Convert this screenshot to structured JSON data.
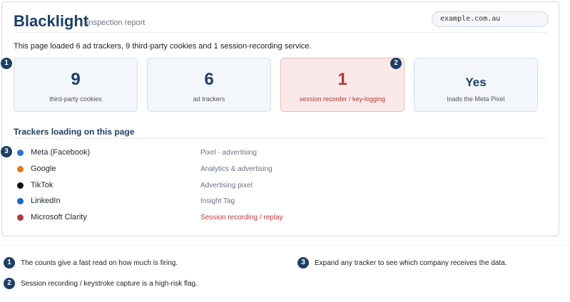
{
  "header": {
    "brand": "Blacklight",
    "subtitle": "inspection report",
    "url": "example.com.au"
  },
  "summary": "This page loaded 6 ad trackers, 9 third-party cookies and 1 session-recording service.",
  "stats": [
    {
      "value": "9",
      "label": "third-party cookies"
    },
    {
      "value": "6",
      "label": "ad trackers"
    },
    {
      "value": "1",
      "label": "session recorder / key-logging"
    },
    {
      "value": "Yes",
      "label": "loads the Meta Pixel"
    }
  ],
  "trackers_title": "Trackers loading on this page",
  "trackers": [
    {
      "name": "Meta (Facebook)",
      "desc": "Pixel · advertising",
      "color": "#2f6fd6"
    },
    {
      "name": "Google",
      "desc": "Analytics & advertising",
      "color": "#e07b1a"
    },
    {
      "name": "TikTok",
      "desc": "Advertising pixel",
      "color": "#111111"
    },
    {
      "name": "LinkedIn",
      "desc": "Insight Tag",
      "color": "#1a66c2"
    },
    {
      "name": "Microsoft Clarity",
      "desc": "Session recording / replay",
      "color": "#b5373a"
    }
  ],
  "badges": [
    "1",
    "2",
    "3"
  ],
  "notes": [
    {
      "n": "1",
      "text": "The counts give a fast read on how much is firing."
    },
    {
      "n": "2",
      "text": "Session recording / keystroke capture is a high-risk flag."
    },
    {
      "n": "3",
      "text": "Expand any tracker to see which company receives the data."
    }
  ],
  "colors": {
    "brand": "#1d3f66",
    "alert": "#b5373a",
    "alert_bg": "#fbe9e9"
  }
}
